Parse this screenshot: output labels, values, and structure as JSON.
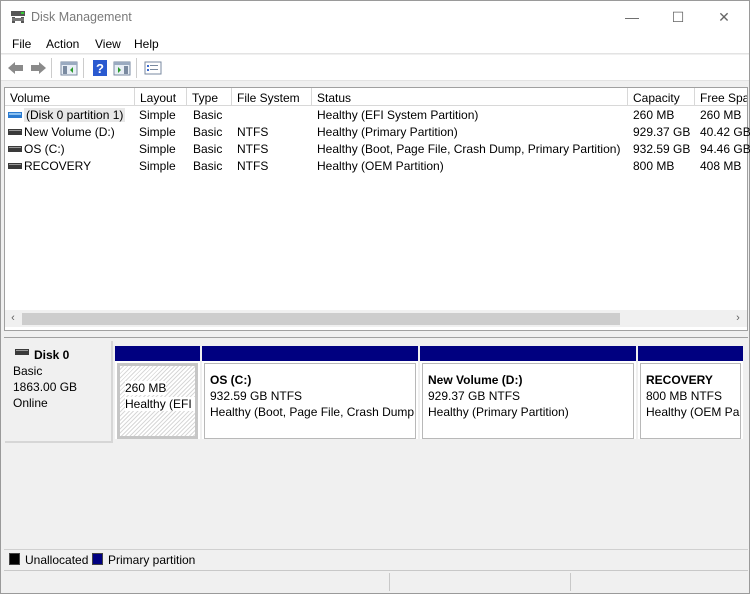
{
  "window": {
    "title": "Disk Management",
    "minimize_icon": "minimize-icon",
    "maximize_icon": "maximize-icon",
    "close_icon": "close-icon",
    "minimize_glyph": "—",
    "maximize_glyph": "☐",
    "close_glyph": "✕"
  },
  "menu": {
    "items": [
      {
        "label": "File"
      },
      {
        "label": "Action"
      },
      {
        "label": "View"
      },
      {
        "label": "Help"
      }
    ]
  },
  "toolbar": {
    "buttons": [
      {
        "name": "back-icon"
      },
      {
        "name": "forward-icon"
      },
      {
        "name": "show-hide-console-tree-icon"
      },
      {
        "name": "help-icon"
      },
      {
        "name": "show-hide-action-pane-icon"
      },
      {
        "name": "properties-icon"
      }
    ]
  },
  "volume_list": {
    "columns": [
      "Volume",
      "Layout",
      "Type",
      "File System",
      "Status",
      "Capacity",
      "Free Spa"
    ],
    "rows": [
      {
        "volume": "(Disk 0 partition 1)",
        "layout": "Simple",
        "type": "Basic",
        "fs": "",
        "status": "Healthy (EFI System Partition)",
        "capacity": "260 MB",
        "free": "260 MB",
        "icon": "blue"
      },
      {
        "volume": "New Volume (D:)",
        "layout": "Simple",
        "type": "Basic",
        "fs": "NTFS",
        "status": "Healthy (Primary Partition)",
        "capacity": "929.37 GB",
        "free": "40.42 GB",
        "icon": "dark"
      },
      {
        "volume": "OS (C:)",
        "layout": "Simple",
        "type": "Basic",
        "fs": "NTFS",
        "status": "Healthy (Boot, Page File, Crash Dump, Primary Partition)",
        "capacity": "932.59 GB",
        "free": "94.46 GB",
        "icon": "dark"
      },
      {
        "volume": "RECOVERY",
        "layout": "Simple",
        "type": "Basic",
        "fs": "NTFS",
        "status": "Healthy (OEM Partition)",
        "capacity": "800 MB",
        "free": "408 MB",
        "icon": "dark"
      }
    ],
    "scroll_left": "‹",
    "scroll_right": "›"
  },
  "disk_map": {
    "disk": {
      "name": "Disk 0",
      "type": "Basic",
      "size": "1863.00 GB",
      "state": "Online"
    },
    "partitions": [
      {
        "title": "",
        "size": "260 MB",
        "status": "Healthy (EFI S"
      },
      {
        "title": "OS  (C:)",
        "size": "932.59 GB NTFS",
        "status": "Healthy (Boot, Page File, Crash Dump,"
      },
      {
        "title": "New Volume  (D:)",
        "size": "929.37 GB NTFS",
        "status": "Healthy (Primary Partition)"
      },
      {
        "title": "RECOVERY",
        "size": "800 MB NTFS",
        "status": "Healthy (OEM Par"
      }
    ]
  },
  "legend": {
    "items": [
      {
        "label": "Unallocated",
        "color": "#000000"
      },
      {
        "label": "Primary partition",
        "color": "#000080"
      }
    ]
  },
  "colors": {
    "primary_partition": "#000080",
    "unallocated": "#000000"
  }
}
